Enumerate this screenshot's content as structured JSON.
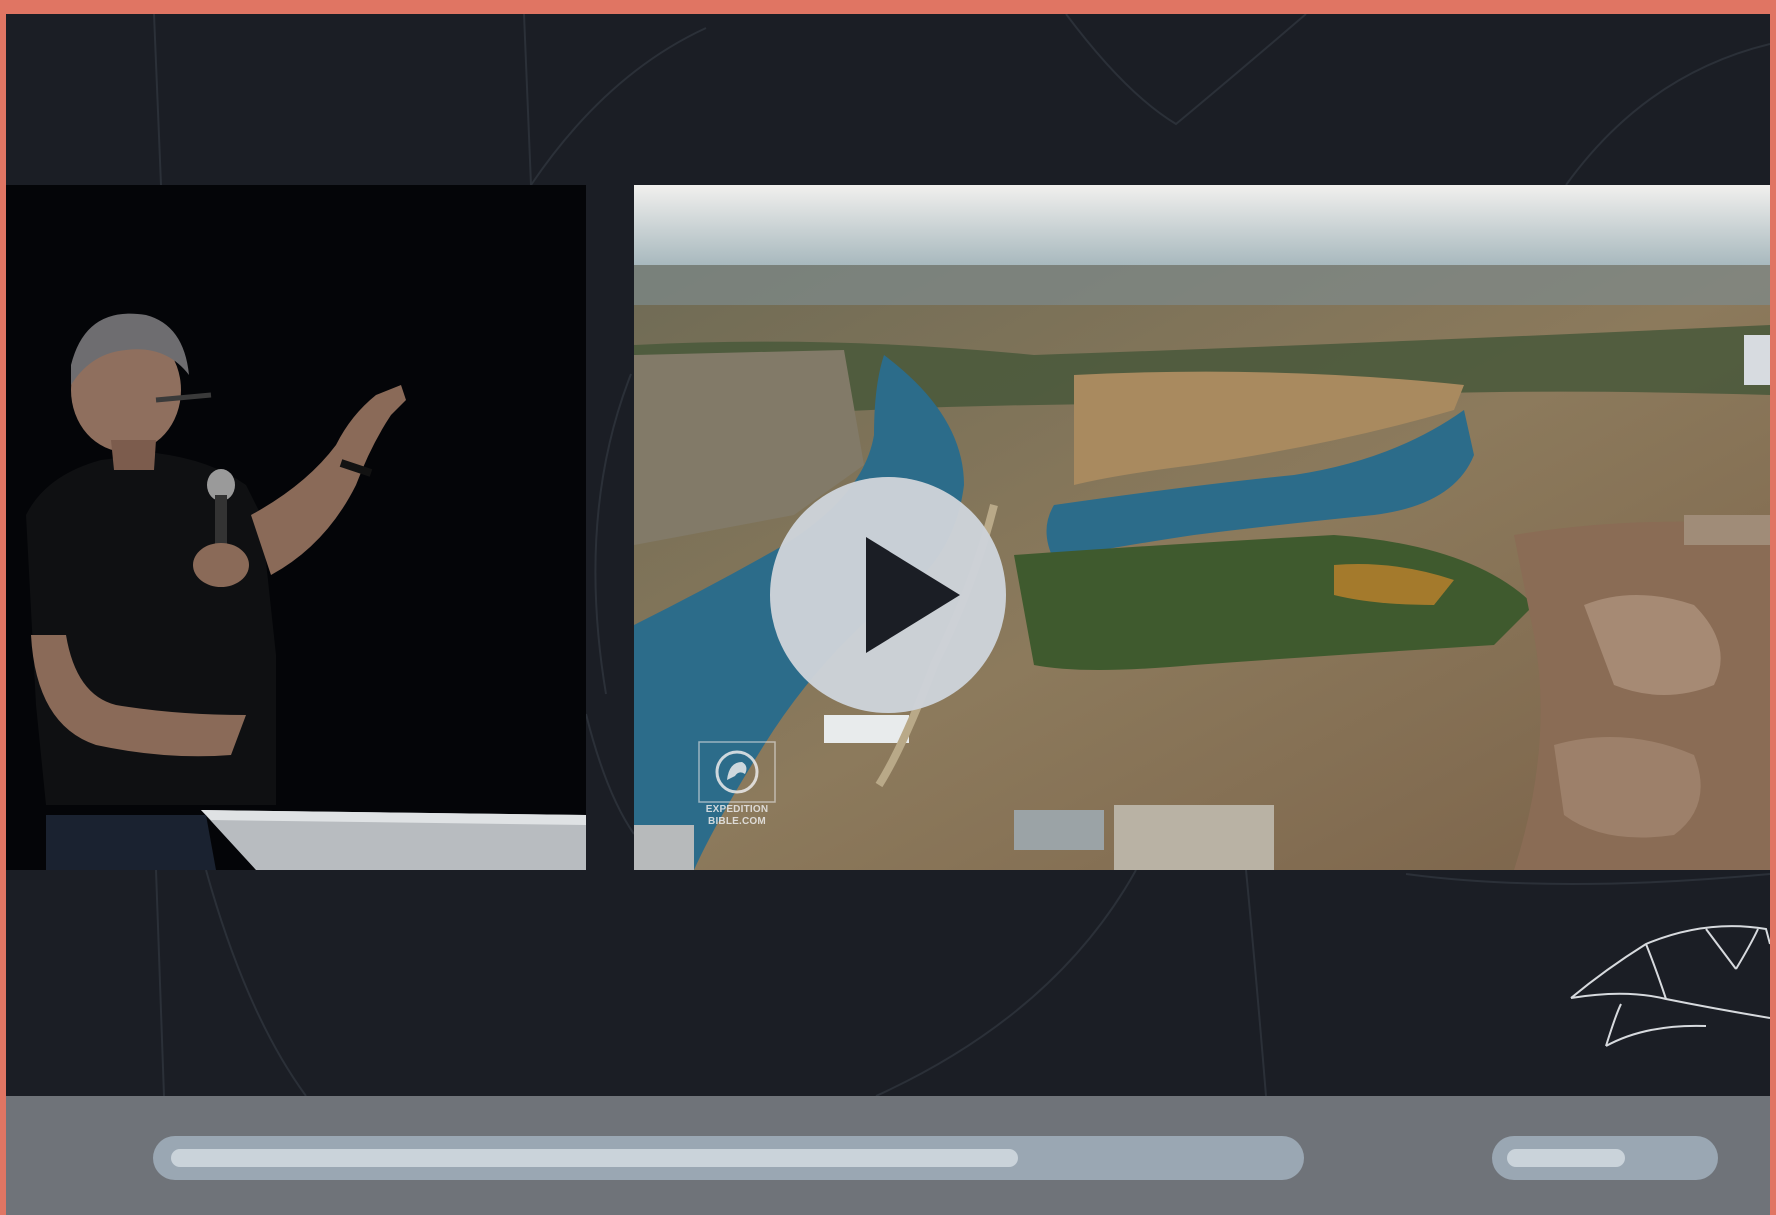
{
  "player": {
    "state": "paused",
    "accent_color": "#e07563",
    "background_color": "#1b1e25"
  },
  "video": {
    "watermark_line1": "EXPEDITION",
    "watermark_line2": "BIBLE.COM"
  },
  "controls": {
    "play_icon": "play-icon",
    "progress_fraction": 0.76,
    "volume_fraction": 0.6
  }
}
